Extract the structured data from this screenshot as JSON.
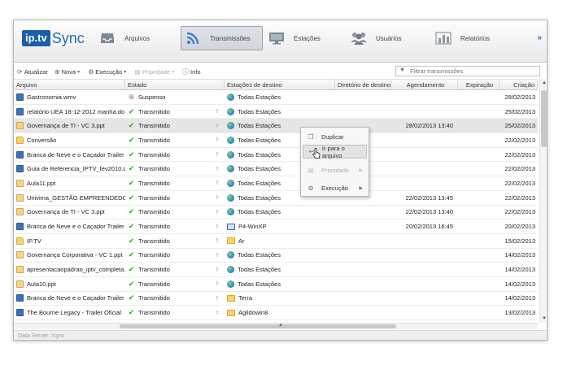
{
  "logo": {
    "brand": "ip.tv",
    "product": "Sync"
  },
  "nav": {
    "items": [
      {
        "label": "Arquivos",
        "icon": "inbox-icon"
      },
      {
        "label": "Transmissões",
        "icon": "rss-icon"
      },
      {
        "label": "Estações",
        "icon": "monitor-icon"
      },
      {
        "label": "Usuários",
        "icon": "users-icon"
      },
      {
        "label": "Relatórios",
        "icon": "bar-chart-icon"
      }
    ],
    "active": "Transmissões",
    "more": "»"
  },
  "toolbar": {
    "refresh": "Atualizar",
    "new": "Nova",
    "execution": "Execução",
    "priority": "Prioridade",
    "info": "Info",
    "filter_placeholder": "Filtrar transmissões"
  },
  "columns": [
    "Arquivo",
    "Estado",
    "Estações de destino",
    "Diretório de destino",
    "Agendamento",
    "Expiração",
    "Criação"
  ],
  "rows": [
    {
      "file": "Gastronomia.wmv",
      "ftype": "video",
      "status": "Suspenso",
      "sicon": "pause",
      "dest": "Todas Estações",
      "dtype": "globe",
      "dir": "",
      "agend": "",
      "exp": "",
      "cri": "28/02/2013"
    },
    {
      "file": "relatório UEA 18-12-2012 manha.do",
      "ftype": "video",
      "status": "Transmitido",
      "sicon": "ok",
      "dest": "Todas Estações",
      "dtype": "globe",
      "dir": "",
      "agend": "",
      "exp": "",
      "cri": "25/02/2013"
    },
    {
      "file": "Governança de TI - VC 3.ppt",
      "ftype": "doc",
      "status": "Transmitido",
      "sicon": "ok",
      "dest": "Todas Estações",
      "dtype": "globe",
      "dir": "",
      "agend": "28/02/2013 13:40",
      "exp": "",
      "cri": "25/02/2013",
      "selected": true
    },
    {
      "file": "Conversão",
      "ftype": "folder",
      "status": "Transmitido",
      "sicon": "ok",
      "dest": "Todas Estações",
      "dtype": "globe",
      "dir": "",
      "agend": "",
      "exp": "",
      "cri": "22/02/2013"
    },
    {
      "file": "Branca de Neve e o Caçador Trailer",
      "ftype": "video",
      "status": "Transmitido",
      "sicon": "ok",
      "dest": "Todas Estações",
      "dtype": "globe",
      "dir": "",
      "agend": "",
      "exp": "",
      "cri": "22/02/2013"
    },
    {
      "file": "Guia de Referencia_IPTV_fev2010.d",
      "ftype": "video",
      "status": "Transmitido",
      "sicon": "ok",
      "dest": "Todas Estações",
      "dtype": "globe",
      "dir": "",
      "agend": "",
      "exp": "",
      "cri": "22/02/2013"
    },
    {
      "file": "Aula11.ppt",
      "ftype": "doc",
      "status": "Transmitido",
      "sicon": "ok",
      "dest": "Todas Estações",
      "dtype": "globe",
      "dir": "",
      "agend": "",
      "exp": "",
      "cri": "22/02/2013"
    },
    {
      "file": "Univima_GESTÃO EMPREENDEDOR",
      "ftype": "doc",
      "status": "Transmitido",
      "sicon": "ok",
      "dest": "Todas Estações",
      "dtype": "globe",
      "dir": "",
      "agend": "22/02/2013 13:45",
      "exp": "",
      "cri": "22/02/2013"
    },
    {
      "file": "Governança de TI - VC 3.ppt",
      "ftype": "doc",
      "status": "Transmitido",
      "sicon": "ok",
      "dest": "Todas Estações",
      "dtype": "globe",
      "dir": "",
      "agend": "22/02/2013 13:40",
      "exp": "",
      "cri": "22/02/2013"
    },
    {
      "file": "Branca de Neve e o Caçador Trailer",
      "ftype": "video",
      "status": "Transmitido",
      "sicon": "ok",
      "dest": "P4-WinXP",
      "dtype": "monitor",
      "dir": "",
      "agend": "20/02/2013 16:45",
      "exp": "",
      "cri": "20/02/2013"
    },
    {
      "file": "IP.TV",
      "ftype": "folder",
      "status": "Transmitido",
      "sicon": "ok",
      "dest": "Ar",
      "dtype": "folder",
      "dir": "",
      "agend": "",
      "exp": "",
      "cri": "15/02/2013"
    },
    {
      "file": "Governança Corporativa - VC 1.ppt",
      "ftype": "doc",
      "status": "Transmitido",
      "sicon": "ok",
      "dest": "Todas Estações",
      "dtype": "globe",
      "dir": "",
      "agend": "",
      "exp": "",
      "cri": "14/02/2013"
    },
    {
      "file": "apresentacaopadrao_iptv_completa.",
      "ftype": "doc",
      "status": "Transmitido",
      "sicon": "ok",
      "dest": "Todas Estações",
      "dtype": "globe",
      "dir": "",
      "agend": "",
      "exp": "",
      "cri": "14/02/2013"
    },
    {
      "file": "Aula10.ppt",
      "ftype": "doc",
      "status": "Transmitido",
      "sicon": "ok",
      "dest": "Todas Estações",
      "dtype": "globe",
      "dir": "",
      "agend": "",
      "exp": "",
      "cri": "14/02/2013"
    },
    {
      "file": "Branca de Neve e o Caçador Trailer",
      "ftype": "video",
      "status": "Transmitido",
      "sicon": "ok",
      "dest": "Terra",
      "dtype": "folder",
      "dir": "",
      "agend": "",
      "exp": "",
      "cri": "14/02/2013"
    },
    {
      "file": "The Bourne Legacy - Trailer Oficial",
      "ftype": "video",
      "status": "Transmitido",
      "sicon": "ok",
      "dest": "Agildowin8",
      "dtype": "folder",
      "dir": "",
      "agend": "",
      "exp": "",
      "cri": "13/02/2013"
    }
  ],
  "context_menu": {
    "items": [
      {
        "label": "Duplicar",
        "icon": "copy-icon",
        "state": "normal"
      },
      {
        "label": "Ir para o arquivo",
        "icon": "back-arrow-icon",
        "state": "hover"
      },
      {
        "label": "Prioridade",
        "icon": "priority-icon",
        "state": "disabled",
        "submenu": true
      },
      {
        "label": "Execução",
        "icon": "gear-icon",
        "state": "normal",
        "submenu": true
      }
    ]
  },
  "statusbar": {
    "text": "Data Server: /sync"
  }
}
